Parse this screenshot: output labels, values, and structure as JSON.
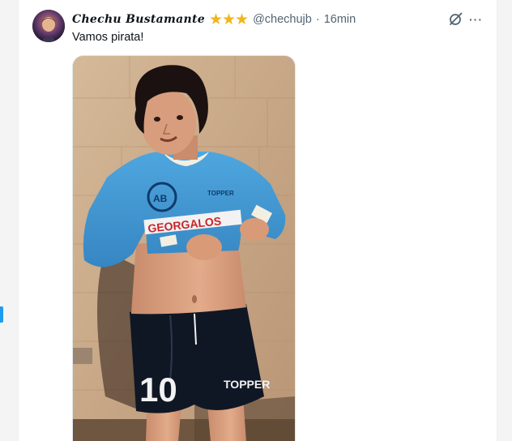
{
  "tweet": {
    "display_name": "Chechu Bustamante",
    "badge": "★★★",
    "handle": "@chechujb",
    "separator": "·",
    "timestamp": "16min",
    "text": "Vamos pirata!"
  },
  "photo": {
    "jersey_sponsor": "GEORGALOS",
    "shorts_number": "10",
    "shorts_brand": "TOPPER",
    "jersey_brand": "TOPPER"
  },
  "icons": {
    "grok": "grok-icon",
    "more": "more-icon",
    "more_glyph": "···"
  },
  "colors": {
    "accent": "#1d9bf0",
    "badge": "#f2b51b",
    "jersey": "#3f9ad4",
    "shorts": "#101724"
  }
}
